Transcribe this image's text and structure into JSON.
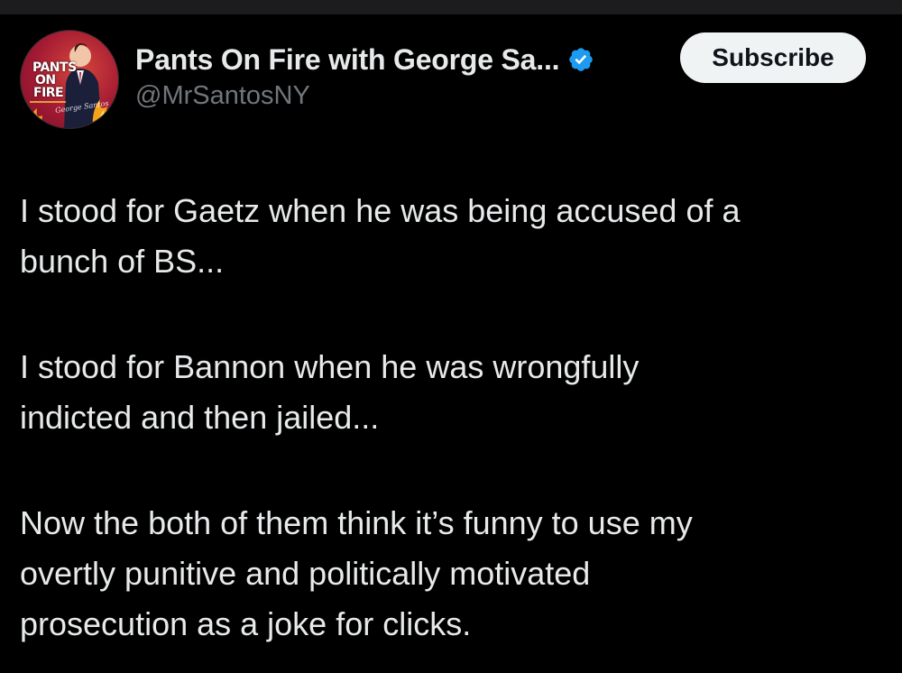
{
  "tweet": {
    "author": {
      "display_name": "Pants On Fire with George Sa...",
      "handle": "@MrSantosNY",
      "verified": true,
      "verified_icon": "verified-badge-icon",
      "verified_color": "#1d9bf0",
      "avatar": {
        "lines": [
          "PANTS",
          "ON",
          "FIRE"
        ],
        "script_text": "George Santos"
      }
    },
    "subscribe_label": "Subscribe",
    "paragraphs": [
      "I stood for Gaetz when he was being accused of a\nbunch of BS...",
      "I stood for Bannon when he was wrongfully\nindicted and then jailed...",
      "Now the both of them think it’s funny to use my\novertly punitive and politically motivated\nprosecution as a joke for clicks."
    ]
  },
  "colors": {
    "background": "#000000",
    "text_primary": "#e7e9ea",
    "text_secondary": "#71767b",
    "button_bg": "#eff3f4",
    "button_text": "#0f1419"
  }
}
